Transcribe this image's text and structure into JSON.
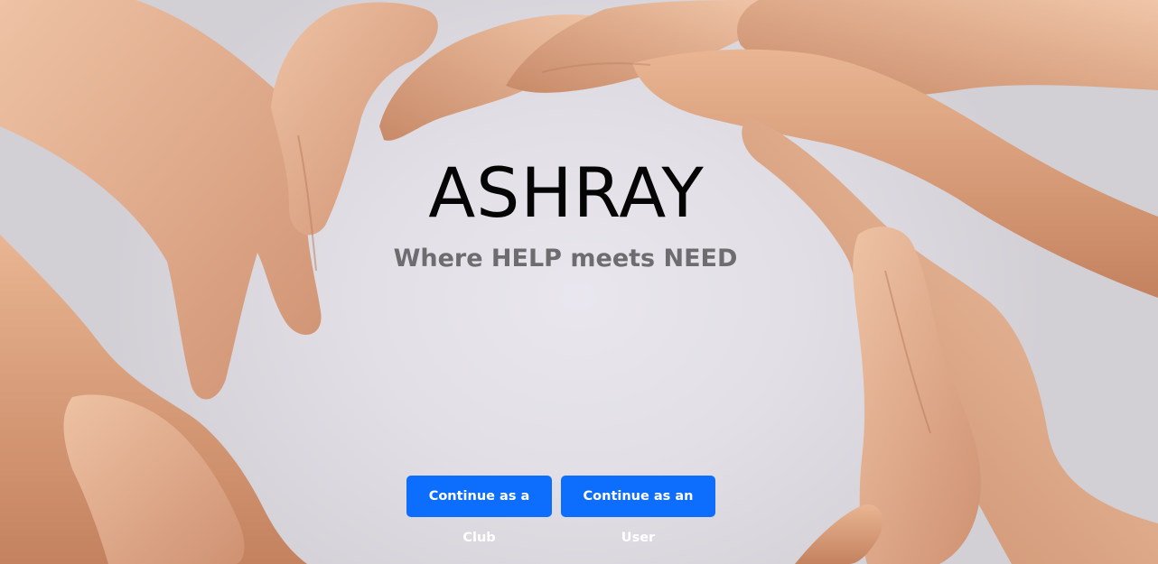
{
  "hero": {
    "brand": "ASHRAY",
    "tagline": "Where HELP meets NEED",
    "background_image": "hands-joined-in-circle",
    "skin_tone_light": "#e8b898",
    "skin_tone_shadow": "#c98d6c"
  },
  "actions": {
    "club_label": "Continue as a Club",
    "user_label": "Continue as an User",
    "button_color": "#0d6efd"
  }
}
